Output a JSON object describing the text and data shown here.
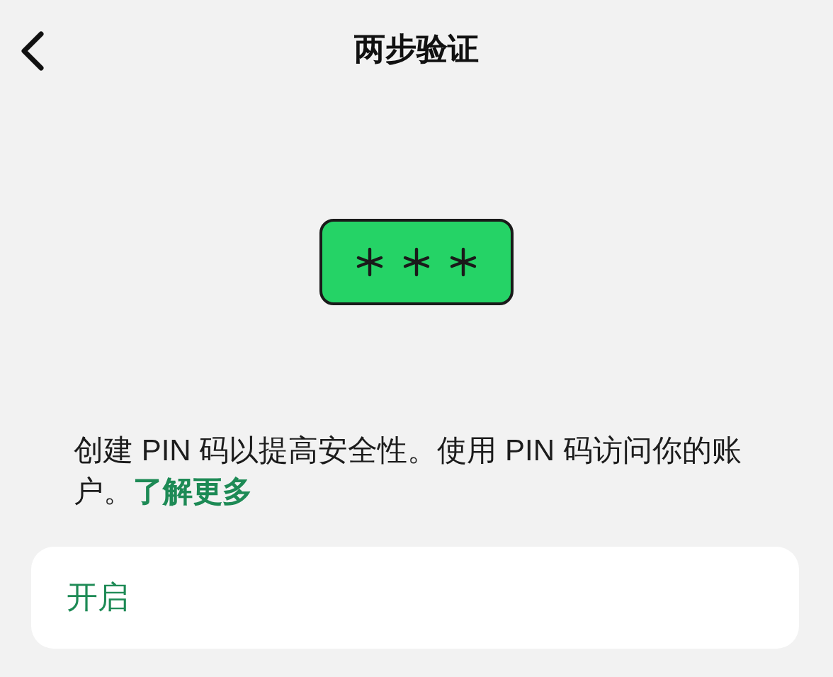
{
  "header": {
    "title": "两步验证"
  },
  "description": {
    "text": "创建 PIN 码以提高安全性。使用 PIN 码访问你的账户。",
    "link": "了解更多"
  },
  "options": [
    {
      "label": "开启"
    }
  ]
}
